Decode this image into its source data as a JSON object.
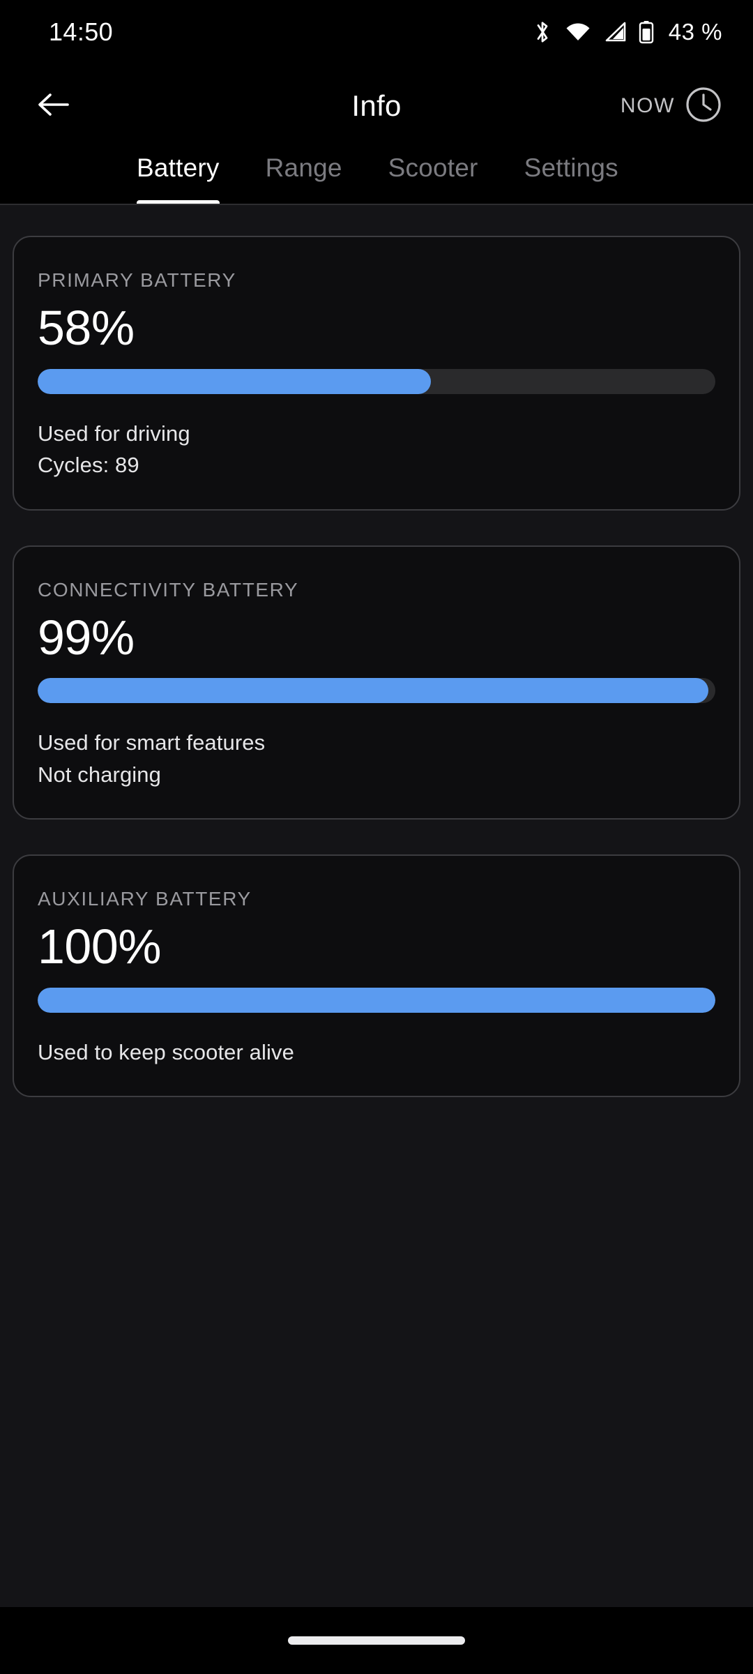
{
  "status_bar": {
    "time": "14:50",
    "bluetooth_icon": "bluetooth-icon",
    "wifi_icon": "wifi-icon",
    "cellular_icon": "cellular-signal-icon",
    "battery_icon": "battery-icon",
    "battery_percent": "43 %"
  },
  "app_bar": {
    "back_icon": "back-arrow-icon",
    "title": "Info",
    "now_label": "NOW",
    "clock_icon": "clock-icon"
  },
  "tabs": [
    {
      "label": "Battery",
      "active": true
    },
    {
      "label": "Range",
      "active": false
    },
    {
      "label": "Scooter",
      "active": false
    },
    {
      "label": "Settings",
      "active": false
    }
  ],
  "cards": [
    {
      "title": "PRIMARY BATTERY",
      "value": "58%",
      "percent": 58,
      "note1": "Used for driving",
      "note2": "Cycles: 89"
    },
    {
      "title": "CONNECTIVITY BATTERY",
      "value": "99%",
      "percent": 99,
      "note1": "Used for smart features",
      "note2": "Not charging"
    },
    {
      "title": "AUXILIARY BATTERY",
      "value": "100%",
      "percent": 100,
      "note1": "Used to keep scooter alive",
      "note2": ""
    }
  ],
  "nav_bar": {
    "home_indicator": "home-indicator"
  },
  "colors": {
    "accent": "#5b9bf0",
    "track": "#2a2a2c",
    "page_bg": "#141417",
    "card_bg": "#0d0d0f",
    "card_border": "#3c3c40",
    "bar_black": "#000000",
    "text_primary": "#ffffff",
    "text_secondary": "#9a9a9f",
    "tab_inactive": "#7b7b80"
  }
}
